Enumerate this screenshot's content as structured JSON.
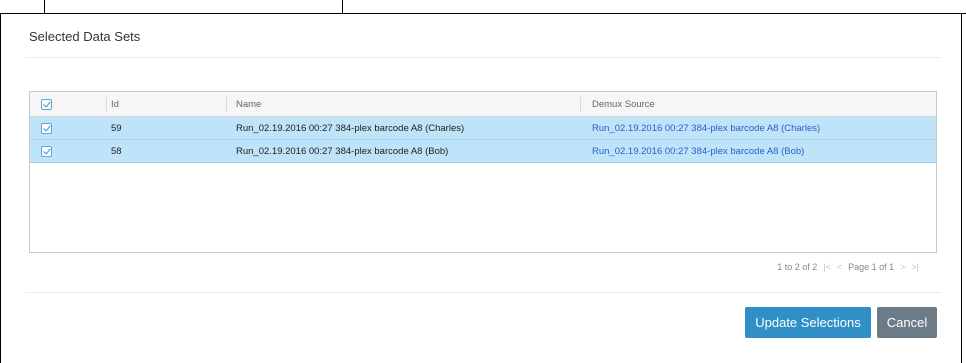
{
  "dialog": {
    "title": "Selected Data Sets"
  },
  "grid": {
    "columns": {
      "id": "Id",
      "name": "Name",
      "demux": "Demux Source"
    },
    "rows": [
      {
        "id": "59",
        "name": "Run_02.19.2016 00:27 384-plex barcode A8 (Charles)",
        "demux": "Run_02.19.2016 00:27 384-plex barcode A8 (Charles)",
        "checked": true
      },
      {
        "id": "58",
        "name": "Run_02.19.2016 00:27 384-plex barcode A8 (Bob)",
        "demux": "Run_02.19.2016 00:27 384-plex barcode A8 (Bob)",
        "checked": true
      }
    ],
    "header_checked": true
  },
  "pager": {
    "range": "1 to 2 of 2",
    "first": "|<",
    "prev": "<",
    "page_label": "Page 1 of 1",
    "next": ">",
    "last": ">|"
  },
  "buttons": {
    "update": "Update Selections",
    "cancel": "Cancel"
  },
  "colors": {
    "selected_row": "#bfe3f9",
    "link": "#2a5fc9",
    "primary_button": "#2f8fc6",
    "secondary_button": "#6d7b86"
  }
}
